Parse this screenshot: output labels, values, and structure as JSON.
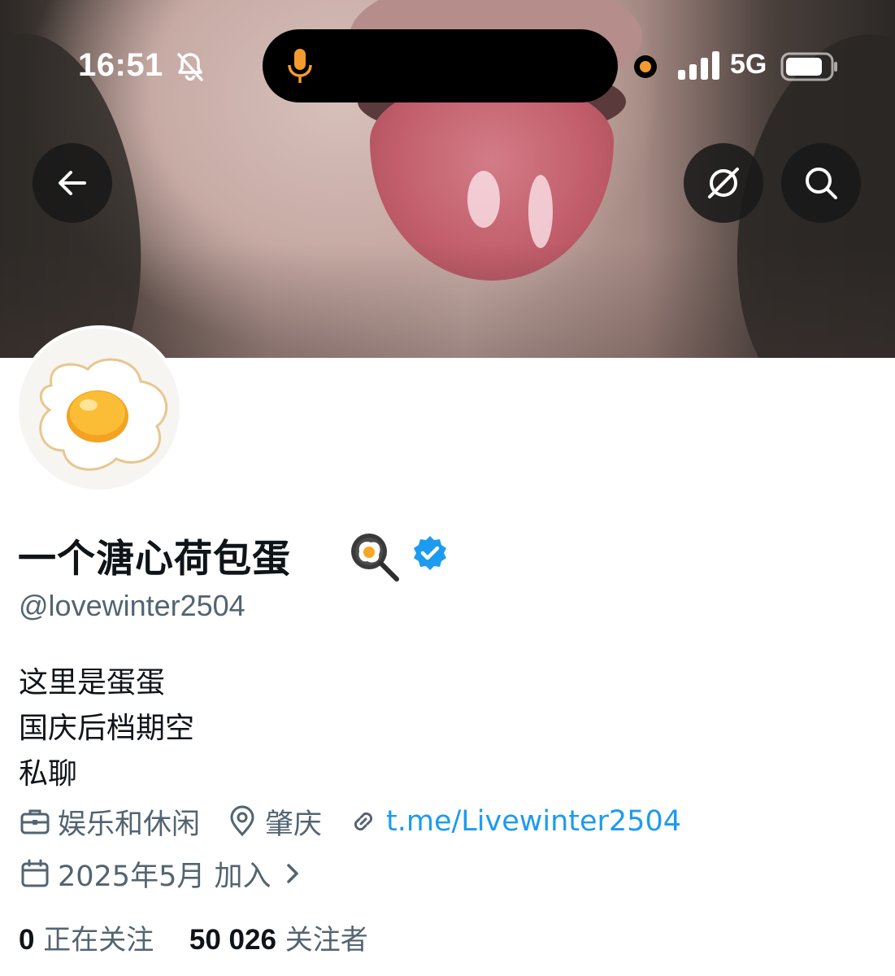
{
  "status_bar": {
    "time": "16:51",
    "network": "5G",
    "icons": [
      "bell-slash-icon",
      "microphone-icon",
      "recording-dot-icon",
      "signal-icon",
      "battery-icon"
    ],
    "accent_color": "#f39b2e"
  },
  "header": {
    "back_icon": "arrow-left-icon",
    "actions": [
      "grok-icon",
      "search-icon"
    ]
  },
  "profile": {
    "display_name": "一个溏心荷包蛋",
    "name_emoji": "frying-pan-egg-emoji",
    "verified": true,
    "verified_color": "#1d9bf0",
    "handle": "@lovewinter2504",
    "avatar": "fried-egg-avatar",
    "bio": [
      "这里是蛋蛋",
      "国庆后档期空",
      "私聊"
    ],
    "category": "娱乐和休闲",
    "location": "肇庆",
    "link": "t.me/Livewinter2504",
    "joined": "2025年5月 加入",
    "following_count": "0",
    "following_label": "正在关注",
    "followers_count": "50 026",
    "followers_label": "关注者"
  }
}
